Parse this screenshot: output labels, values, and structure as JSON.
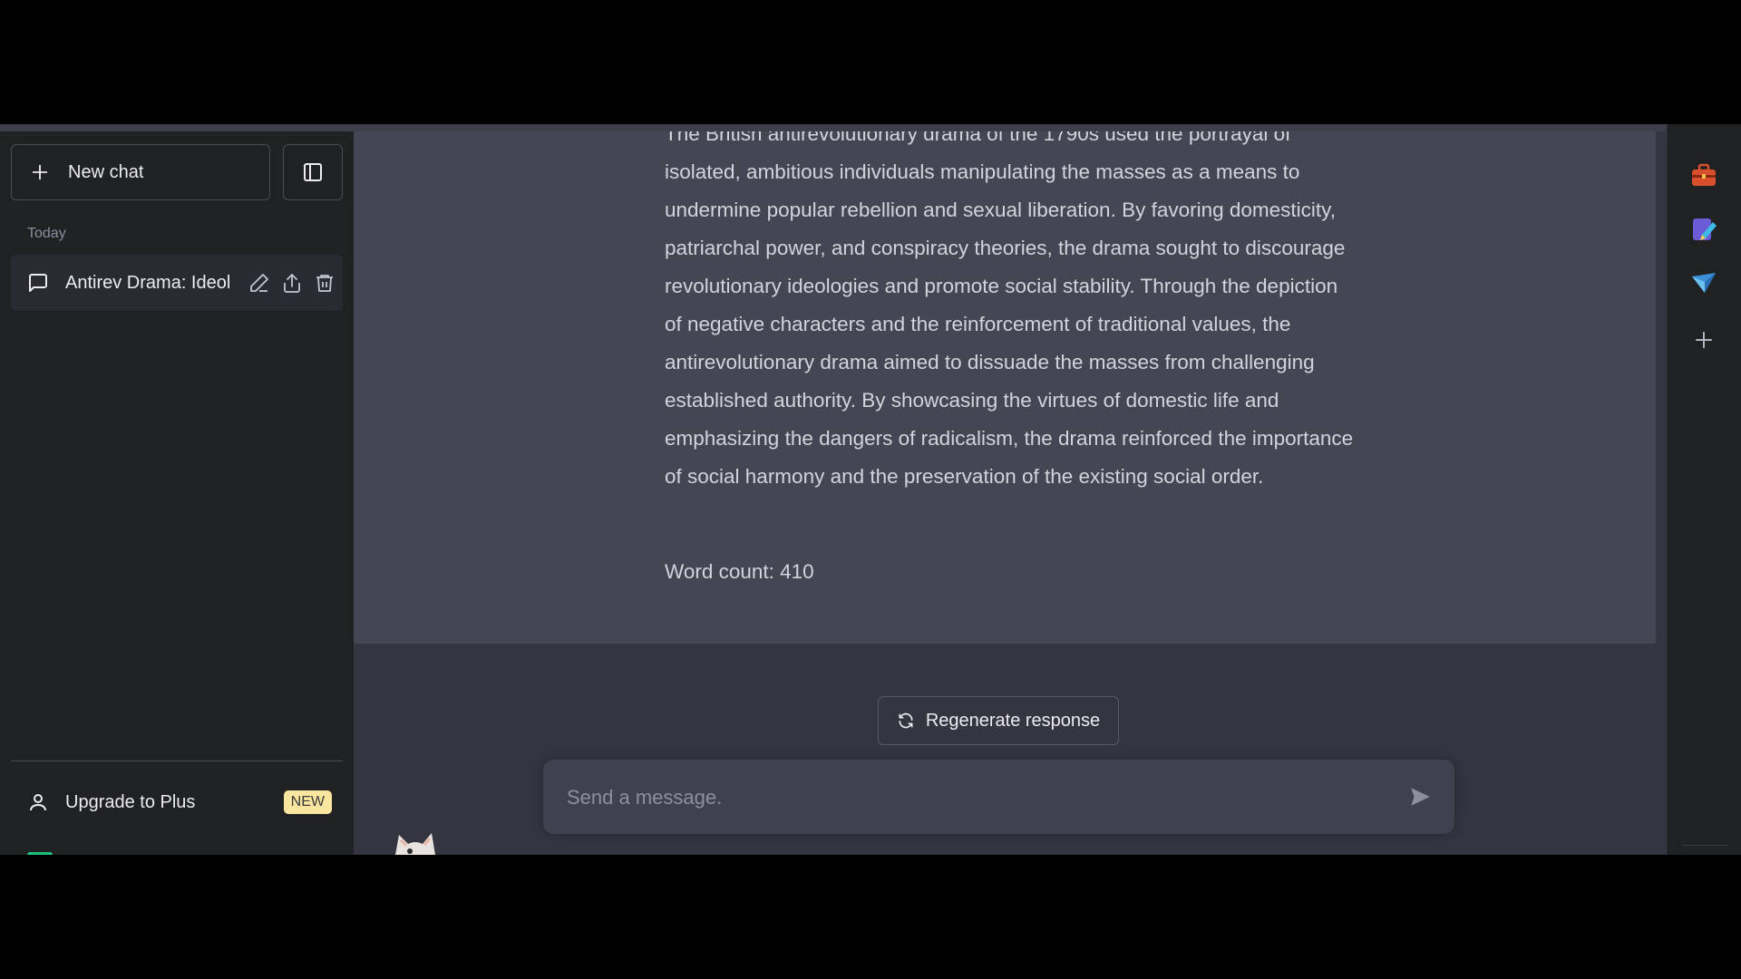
{
  "sidebar": {
    "new_chat_label": "New chat",
    "section_today": "Today",
    "chat_items": [
      {
        "title": "Antirev Drama: Ideol"
      }
    ],
    "upgrade_label": "Upgrade to Plus",
    "upgrade_badge": "NEW"
  },
  "conversation": {
    "assistant_message": "The British antirevolutionary drama of the 1790s used the portrayal of isolated, ambitious individuals manipulating the masses as a means to undermine popular rebellion and sexual liberation. By favoring domesticity, patriarchal power, and conspiracy theories, the drama sought to discourage revolutionary ideologies and promote social stability. Through the depiction of negative characters and the reinforcement of traditional values, the antirevolutionary drama aimed to dissuade the masses from challenging established authority. By showcasing the virtues of domestic life and emphasizing the dangers of radicalism, the drama reinforced the importance of social harmony and the preservation of the existing social order.",
    "word_count": "Word count: 410"
  },
  "composer": {
    "regenerate_label": "Regenerate response",
    "placeholder": "Send a message."
  },
  "rail": {
    "icons": [
      "briefcase-icon",
      "edit-app-icon",
      "send-plane-icon",
      "plus-icon"
    ]
  },
  "colors": {
    "sidebar_bg": "#202123",
    "main_bg": "#343541",
    "assistant_bg": "#444654",
    "badge_bg": "#fae69e",
    "accent_green": "#19c37d"
  }
}
